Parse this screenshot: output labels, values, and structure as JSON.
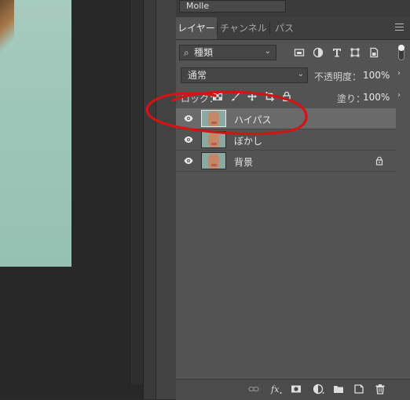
{
  "font_field": {
    "value": "Molle"
  },
  "tabs": [
    {
      "label": "レイヤー",
      "active": true
    },
    {
      "label": "チャンネル",
      "active": false
    },
    {
      "label": "パス",
      "active": false
    }
  ],
  "filter": {
    "search_icon": "⌕",
    "kind_label": "種類",
    "buttons": [
      "pixel-filter-icon",
      "adjustment-filter-icon",
      "text-filter-icon",
      "shape-filter-icon",
      "smart-object-filter-icon"
    ]
  },
  "blend": {
    "mode": "通常",
    "opacity_label": "不透明度：",
    "opacity_value": "100%"
  },
  "lock": {
    "label": "ロック：",
    "fill_label": "塗り：",
    "fill_value": "100%"
  },
  "layers": [
    {
      "name": "ハイパス",
      "selected": true,
      "visible": true,
      "locked": false
    },
    {
      "name": "ぼかし",
      "selected": false,
      "visible": true,
      "locked": false
    },
    {
      "name": "背景",
      "selected": false,
      "visible": true,
      "locked": true
    }
  ],
  "colors": {
    "panel_bg": "#535353",
    "selected_layer": "#6a6a6a",
    "annotation_red": "#d11414"
  }
}
